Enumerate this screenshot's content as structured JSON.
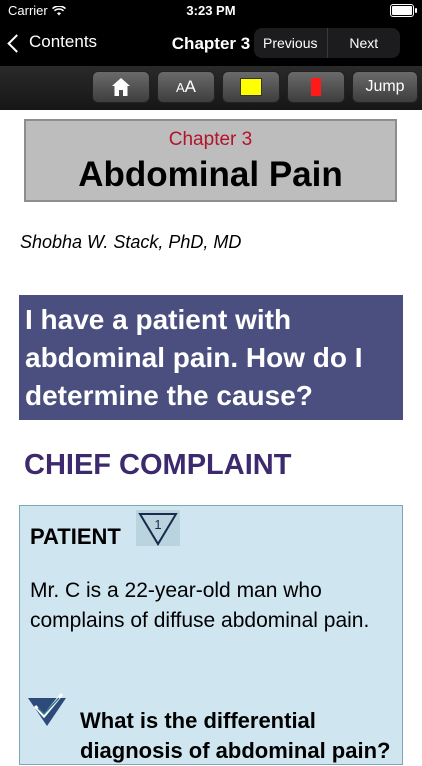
{
  "status_bar": {
    "carrier": "Carrier",
    "time": "3:23 PM",
    "wifi_icon": "wifi-icon",
    "battery_icon": "battery-icon"
  },
  "nav_bar": {
    "back_label": "Contents",
    "title": "Chapter 3",
    "previous_label": "Previous",
    "next_label": "Next"
  },
  "toolbar": {
    "home_icon": "home-icon",
    "font_size_label_small": "A",
    "font_size_label_large": "A",
    "highlight_color": "#ffff00",
    "bookmark_color": "#ff1a1a",
    "jump_label": "Jump"
  },
  "content": {
    "chapter_number": "Chapter 3",
    "chapter_title": "Abdominal Pain",
    "author": "Shobha W. Stack, PhD, MD",
    "question": "I have a patient with abdominal pain. How do I determine the cause?",
    "section_heading": "CHIEF COMPLAINT",
    "patient_label": "PATIENT",
    "patient_badge": "1",
    "case_text": "Mr. C is a 22-year-old man who complains of diffuse abdominal pain.",
    "differential_question": "What is the differential diagnosis of abdominal pain?"
  },
  "colors": {
    "chapter_number": "#b3132b",
    "question_bg": "#4b4f80",
    "section_heading": "#3d2a6e",
    "patient_box_bg": "#cfe5ef"
  }
}
